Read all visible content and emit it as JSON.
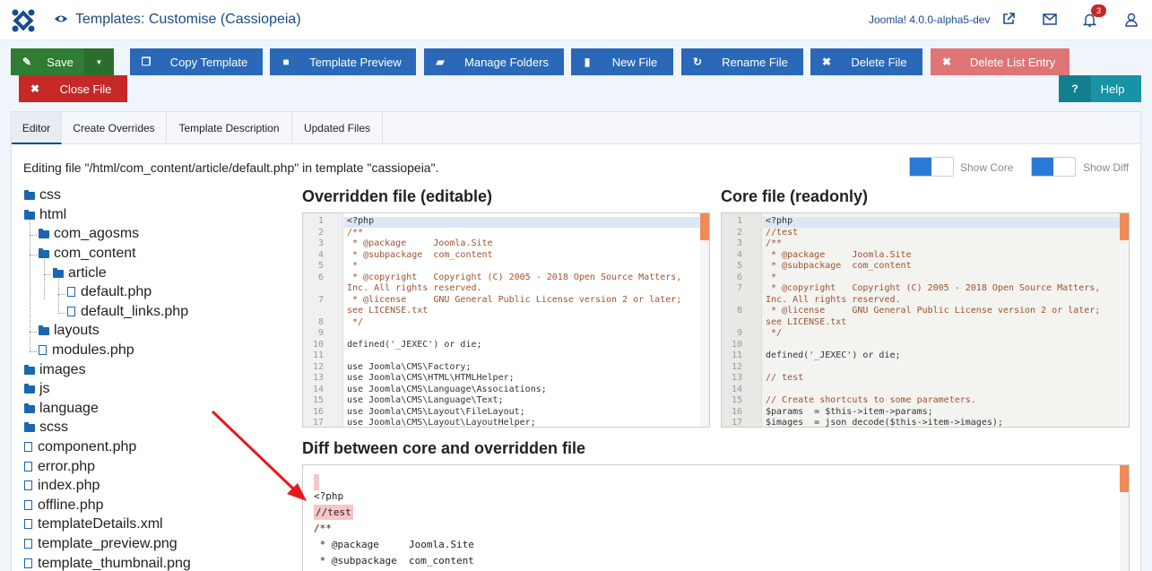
{
  "header": {
    "title": "Templates: Customise (Cassiopeia)",
    "version": "Joomla! 4.0.0-alpha5-dev",
    "notifications_count": "3"
  },
  "toolbar": {
    "save": "Save",
    "copy_template": "Copy Template",
    "template_preview": "Template Preview",
    "manage_folders": "Manage Folders",
    "new_file": "New File",
    "rename_file": "Rename File",
    "delete_file": "Delete File",
    "delete_list_entry": "Delete List Entry",
    "close_file": "Close File",
    "help": "Help"
  },
  "tabs": [
    "Editor",
    "Create Overrides",
    "Template Description",
    "Updated Files"
  ],
  "editing_text": "Editing file \"/html/com_content/article/default.php\" in template \"cassiopeia\".",
  "toggles": {
    "show_core": "Show Core",
    "show_diff": "Show Diff"
  },
  "tree": {
    "css": "css",
    "html": "html",
    "com_agosms": "com_agosms",
    "com_content": "com_content",
    "article": "article",
    "default_php": "default.php",
    "default_links_php": "default_links.php",
    "layouts": "layouts",
    "modules_php": "modules.php",
    "images": "images",
    "js": "js",
    "language": "language",
    "scss": "scss",
    "component_php": "component.php",
    "error_php": "error.php",
    "index_php": "index.php",
    "offline_php": "offline.php",
    "templateDetails_xml": "templateDetails.xml",
    "template_preview_png": "template_preview.png",
    "template_thumbnail_png": "template_thumbnail.png"
  },
  "overridden": {
    "title": "Overridden file (editable)",
    "lines": [
      {
        "n": "1",
        "t": "<?php",
        "c": false
      },
      {
        "n": "2",
        "t": "/**",
        "c": true
      },
      {
        "n": "3",
        "t": " * @package     Joomla.Site",
        "c": true
      },
      {
        "n": "4",
        "t": " * @subpackage  com_content",
        "c": true
      },
      {
        "n": "5",
        "t": " *",
        "c": true
      },
      {
        "n": "6",
        "t": " * @copyright   Copyright (C) 2005 - 2018 Open Source Matters,",
        "c": true
      },
      {
        "n": "",
        "t": "Inc. All rights reserved.",
        "c": true
      },
      {
        "n": "7",
        "t": " * @license     GNU General Public License version 2 or later;",
        "c": true
      },
      {
        "n": "",
        "t": "see LICENSE.txt",
        "c": true
      },
      {
        "n": "8",
        "t": " */",
        "c": true
      },
      {
        "n": "9",
        "t": "",
        "c": false
      },
      {
        "n": "10",
        "t": "defined('_JEXEC') or die;",
        "c": false
      },
      {
        "n": "11",
        "t": "",
        "c": false
      },
      {
        "n": "12",
        "t": "use Joomla\\CMS\\Factory;",
        "c": false
      },
      {
        "n": "13",
        "t": "use Joomla\\CMS\\HTML\\HTMLHelper;",
        "c": false
      },
      {
        "n": "14",
        "t": "use Joomla\\CMS\\Language\\Associations;",
        "c": false
      },
      {
        "n": "15",
        "t": "use Joomla\\CMS\\Language\\Text;",
        "c": false
      },
      {
        "n": "16",
        "t": "use Joomla\\CMS\\Layout\\FileLayout;",
        "c": false
      },
      {
        "n": "17",
        "t": "use Joomla\\CMS\\Layout\\LayoutHelper;",
        "c": false
      }
    ]
  },
  "core": {
    "title": "Core file (readonly)",
    "lines": [
      {
        "n": "1",
        "t": "<?php",
        "c": false
      },
      {
        "n": "2",
        "t": "//test",
        "c": true
      },
      {
        "n": "3",
        "t": "/**",
        "c": true
      },
      {
        "n": "4",
        "t": " * @package     Joomla.Site",
        "c": true
      },
      {
        "n": "5",
        "t": " * @subpackage  com_content",
        "c": true
      },
      {
        "n": "6",
        "t": " *",
        "c": true
      },
      {
        "n": "7",
        "t": " * @copyright   Copyright (C) 2005 - 2018 Open Source Matters,",
        "c": true
      },
      {
        "n": "",
        "t": "Inc. All rights reserved.",
        "c": true
      },
      {
        "n": "8",
        "t": " * @license     GNU General Public License version 2 or later;",
        "c": true
      },
      {
        "n": "",
        "t": "see LICENSE.txt",
        "c": true
      },
      {
        "n": "9",
        "t": " */",
        "c": true
      },
      {
        "n": "10",
        "t": "",
        "c": false
      },
      {
        "n": "11",
        "t": "defined('_JEXEC') or die;",
        "c": false
      },
      {
        "n": "12",
        "t": "",
        "c": false
      },
      {
        "n": "13",
        "t": "// test",
        "c": true
      },
      {
        "n": "14",
        "t": "",
        "c": false
      },
      {
        "n": "15",
        "t": "// Create shortcuts to some parameters.",
        "c": true
      },
      {
        "n": "16",
        "t": "$params  = $this->item->params;",
        "c": false
      },
      {
        "n": "17",
        "t": "$images  = json_decode($this->item->images);",
        "c": false
      }
    ]
  },
  "diff": {
    "title": "Diff between core and overridden file",
    "lines": [
      "<?php",
      "//test",
      "/**",
      " * @package     Joomla.Site",
      " * @subpackage  com_content"
    ]
  }
}
